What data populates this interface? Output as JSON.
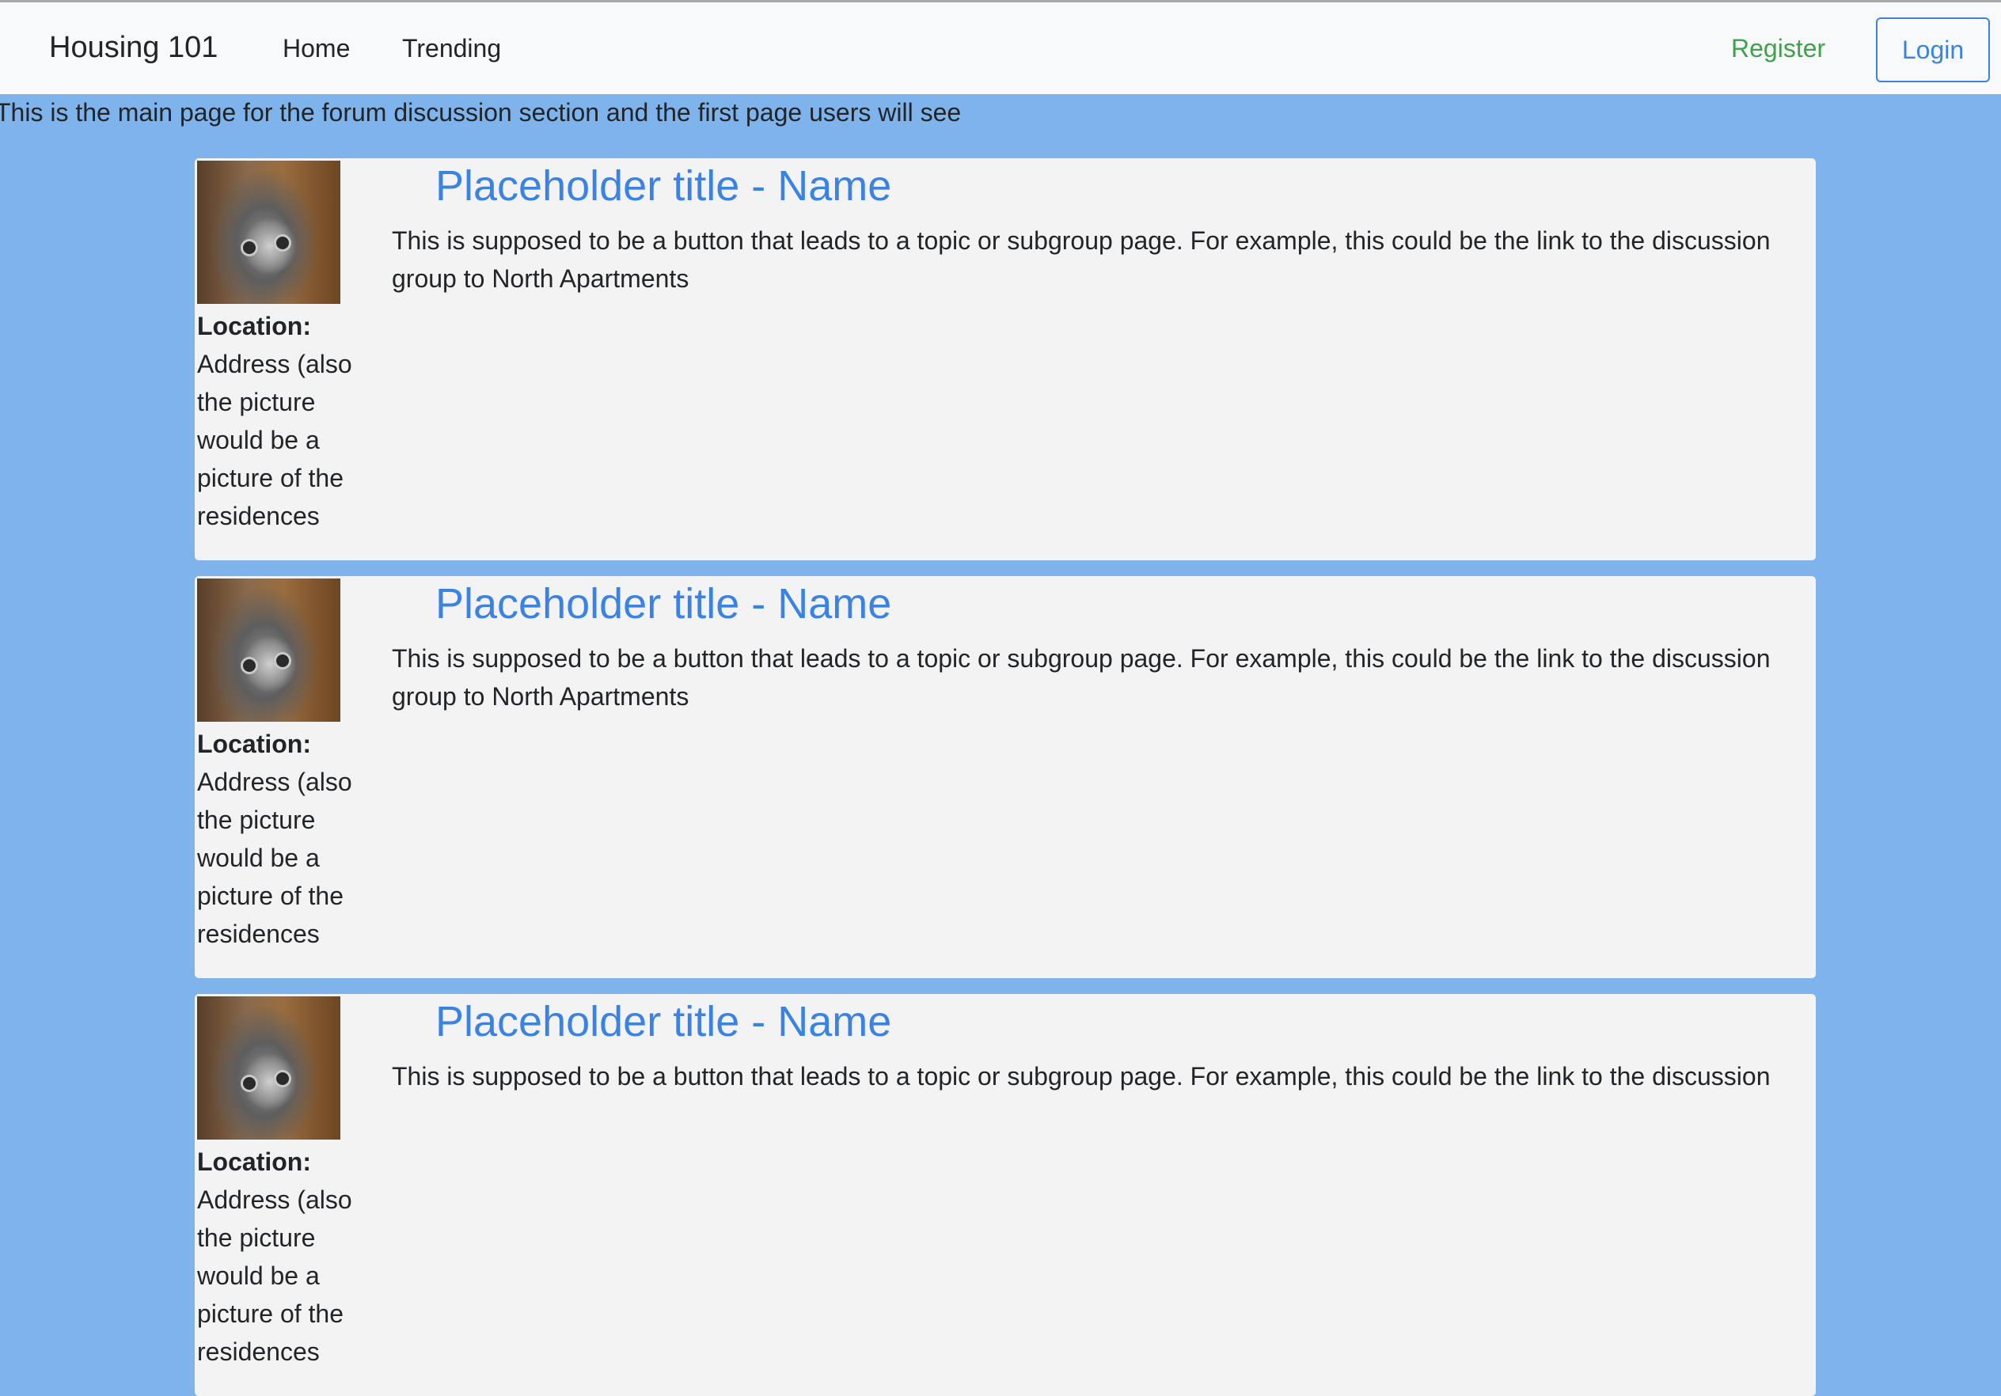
{
  "navbar": {
    "brand": "Housing 101",
    "links": [
      {
        "label": "Home"
      },
      {
        "label": "Trending"
      }
    ],
    "register_label": "Register",
    "login_label": "Login",
    "colors": {
      "register": "#41a04a",
      "login": "#3b83e2"
    }
  },
  "intro": "This is the main page for the forum discussion section and the first page users will see",
  "cards": [
    {
      "title": "Placeholder title - Name",
      "description": "This is supposed to be a button that leads to a topic or subgroup page. For example, this could be the link to the discussion group to North Apartments",
      "location_label": "Location:",
      "location_text": "Address (also the picture would be a picture of the residences",
      "image": "kitten-photo"
    },
    {
      "title": "Placeholder title - Name",
      "description": "This is supposed to be a button that leads to a topic or subgroup page. For example, this could be the link to the discussion group to North Apartments",
      "location_label": "Location:",
      "location_text": "Address (also the picture would be a picture of the residences",
      "image": "kitten-photo"
    },
    {
      "title": "Placeholder title - Name",
      "description": "This is supposed to be a button that leads to a topic or subgroup page. For example, this could be the link to the discussion",
      "location_label": "Location:",
      "location_text": "Address (also the picture would be a picture of the residences",
      "image": "kitten-photo"
    }
  ],
  "colors": {
    "page_background": "#7eb3ec",
    "card_background": "#f3f3f3",
    "title_link": "#3b83e2"
  }
}
